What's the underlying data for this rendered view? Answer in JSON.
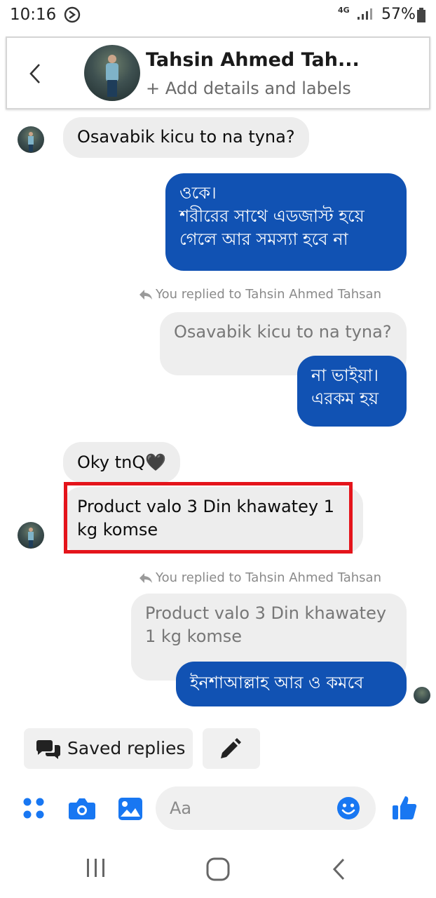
{
  "status_bar": {
    "time": "10:16",
    "network": "4G",
    "battery": "57%"
  },
  "header": {
    "contact_name": "Tahsin Ahmed Tah...",
    "subtitle": "+ Add details and labels"
  },
  "messages": [
    {
      "from": "contact",
      "text": "Osavabik kicu to na tyna?"
    },
    {
      "from": "me",
      "lines": [
        "ওকে।",
        "শরীরের সাথে এডজাস্ট হয়ে",
        "গেলে আর সমস্যা হবে না"
      ]
    },
    {
      "reply_note": "You replied to Tahsin Ahmed Tahsan",
      "quoted": "Osavabik kicu to na tyna?"
    },
    {
      "from": "me",
      "lines": [
        "না ভাইয়া।",
        "এরকম হয়"
      ]
    },
    {
      "from": "contact",
      "text": "Oky tnQ🖤"
    },
    {
      "from": "contact",
      "lines": [
        "Product valo 3 Din khawatey 1",
        "kg komse"
      ]
    },
    {
      "reply_note": "You replied to Tahsin Ahmed Tahsan",
      "quoted_lines": [
        "Product valo 3 Din khawatey",
        "1 kg komse"
      ]
    },
    {
      "from": "me",
      "text": "ইনশাআল্লাহ আর ও কমবে"
    }
  ],
  "quick_actions": {
    "saved_replies": "Saved replies"
  },
  "composer": {
    "placeholder": "Aa"
  },
  "colors": {
    "outgoing": "#1152b3",
    "incoming": "#ededed",
    "accent": "#1877f2",
    "highlight": "#e4141b"
  },
  "icons": [
    "back-arrow-icon",
    "menu-grid-icon",
    "camera-icon",
    "gallery-icon",
    "emoji-icon",
    "thumbs-up-icon",
    "pencil-icon",
    "saved-replies-icon"
  ]
}
